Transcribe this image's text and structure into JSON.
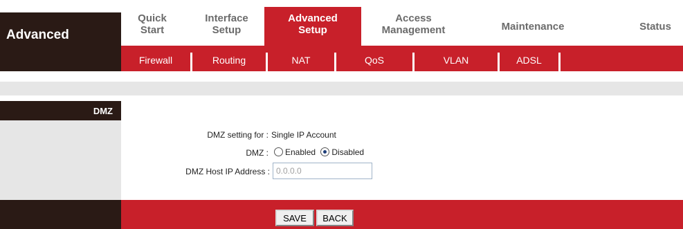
{
  "brand": {
    "title": "Advanced"
  },
  "main_nav": [
    {
      "label": "Quick Start"
    },
    {
      "label": "Interface Setup"
    },
    {
      "label": "Advanced Setup"
    },
    {
      "label": "Access Management"
    },
    {
      "label": "Maintenance"
    },
    {
      "label": "Status"
    }
  ],
  "sub_nav": [
    {
      "label": "Firewall"
    },
    {
      "label": "Routing"
    },
    {
      "label": "NAT"
    },
    {
      "label": "QoS"
    },
    {
      "label": "VLAN"
    },
    {
      "label": "ADSL"
    }
  ],
  "section": {
    "title": "DMZ"
  },
  "form": {
    "setting_for_label": "DMZ setting for :",
    "setting_for_value": "Single IP Account",
    "dmz_label": "DMZ :",
    "enabled_label": "Enabled",
    "disabled_label": "Disabled",
    "selected": "Disabled",
    "host_ip_label": "DMZ Host IP Address :",
    "host_ip_value": "0.0.0.0"
  },
  "buttons": {
    "save": "SAVE",
    "back": "BACK"
  },
  "colors": {
    "accent_red": "#c8202a",
    "dark_brown": "#2a1a15",
    "panel_gray": "#e6e6e6"
  }
}
